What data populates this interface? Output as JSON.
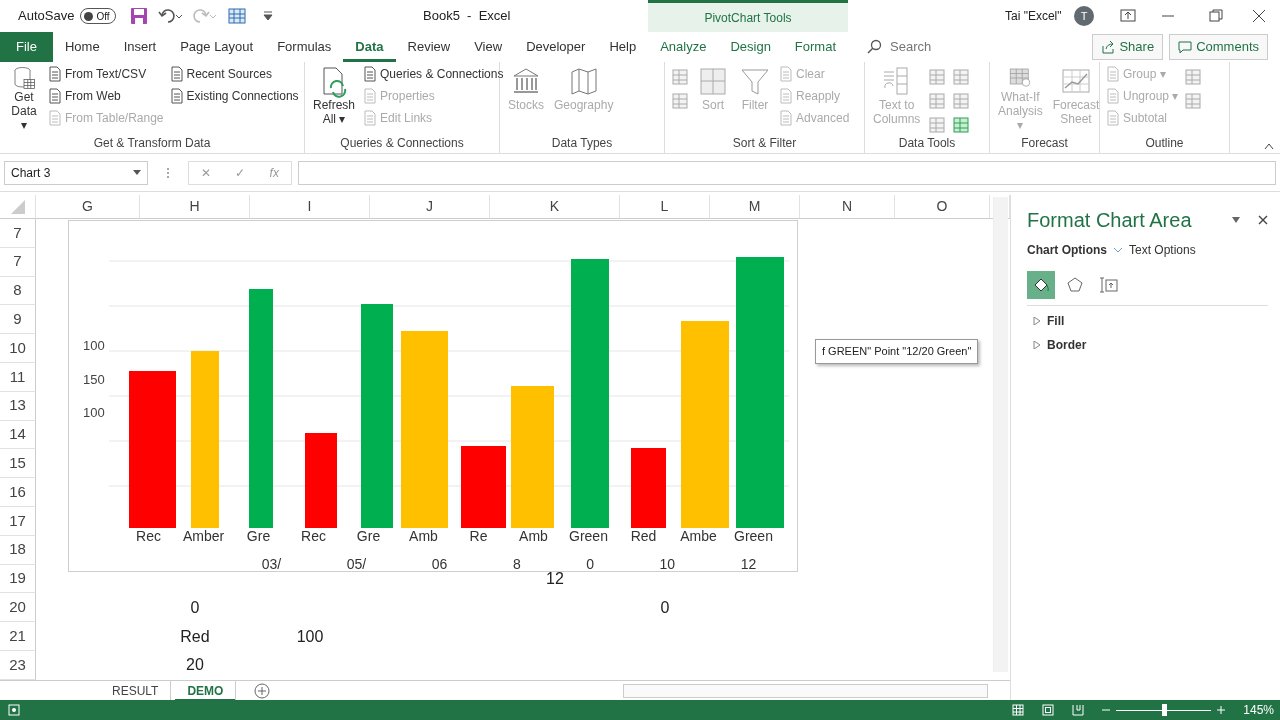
{
  "title_bar": {
    "autosave_label": "AutoSave",
    "autosave_on": false,
    "autosave_state": "Off",
    "document_title": "Book5  -  Excel",
    "context_tab": "PivotChart Tools",
    "user_name": "Tai \"Excel\"",
    "avatar_initial": "T"
  },
  "menu_tabs": [
    {
      "label": "File",
      "kind": "file",
      "selected": false
    },
    {
      "label": "Home",
      "kind": "tab",
      "selected": false
    },
    {
      "label": "Insert",
      "kind": "tab",
      "selected": false
    },
    {
      "label": "Page Layout",
      "kind": "tab",
      "selected": false
    },
    {
      "label": "Formulas",
      "kind": "tab",
      "selected": false
    },
    {
      "label": "Data",
      "kind": "tab",
      "selected": true
    },
    {
      "label": "Review",
      "kind": "tab",
      "selected": false
    },
    {
      "label": "View",
      "kind": "tab",
      "selected": false
    },
    {
      "label": "Developer",
      "kind": "tab",
      "selected": false
    },
    {
      "label": "Help",
      "kind": "tab",
      "selected": false
    },
    {
      "label": "Analyze",
      "kind": "context",
      "selected": false
    },
    {
      "label": "Design",
      "kind": "context",
      "selected": false
    },
    {
      "label": "Format",
      "kind": "context",
      "selected": false
    }
  ],
  "search": {
    "placeholder": "Search"
  },
  "share_button": "Share",
  "comments_button": "Comments",
  "ribbon_groups": [
    {
      "label": "Get & Transform Data",
      "columns": [
        {
          "kind": "large",
          "items": [
            {
              "label": "Get",
              "label2": "Data ▾",
              "disabled": false
            }
          ]
        },
        {
          "kind": "stack",
          "items": [
            {
              "label": "From Text/CSV",
              "disabled": false
            },
            {
              "label": "From Web",
              "disabled": false
            },
            {
              "label": "From Table/Range",
              "disabled": true
            }
          ]
        },
        {
          "kind": "stack",
          "items": [
            {
              "label": "Recent Sources",
              "disabled": false
            },
            {
              "label": "Existing Connections",
              "disabled": false
            }
          ]
        }
      ]
    },
    {
      "label": "Queries & Connections",
      "columns": [
        {
          "kind": "large",
          "items": [
            {
              "label": "Refresh",
              "label2": "All ▾",
              "disabled": false
            }
          ]
        },
        {
          "kind": "stack",
          "items": [
            {
              "label": "Queries & Connections",
              "disabled": false
            },
            {
              "label": "Properties",
              "disabled": true
            },
            {
              "label": "Edit Links",
              "disabled": true
            }
          ]
        }
      ]
    },
    {
      "label": "Data Types",
      "columns": [
        {
          "kind": "large",
          "items": [
            {
              "label": "Stocks",
              "disabled": true
            }
          ]
        },
        {
          "kind": "large",
          "items": [
            {
              "label": "Geography",
              "disabled": true
            }
          ]
        }
      ]
    },
    {
      "label": "Sort & Filter",
      "columns": [
        {
          "kind": "icons",
          "items": [
            {
              "disabled": true
            },
            {
              "disabled": true
            }
          ]
        },
        {
          "kind": "large",
          "items": [
            {
              "label": "Sort",
              "disabled": true
            }
          ]
        },
        {
          "kind": "large",
          "items": [
            {
              "label": "Filter",
              "disabled": true
            }
          ]
        },
        {
          "kind": "stack",
          "items": [
            {
              "label": "Clear",
              "disabled": true
            },
            {
              "label": "Reapply",
              "disabled": true
            },
            {
              "label": "Advanced",
              "disabled": true
            }
          ]
        }
      ]
    },
    {
      "label": "Data Tools",
      "columns": [
        {
          "kind": "large",
          "items": [
            {
              "label": "Text to",
              "label2": "Columns",
              "disabled": true
            }
          ]
        },
        {
          "kind": "icons",
          "items": [
            {
              "disabled": true
            },
            {
              "disabled": true
            },
            {
              "disabled": true
            }
          ]
        },
        {
          "kind": "icons",
          "items": [
            {
              "disabled": true
            },
            {
              "disabled": true
            },
            {
              "disabled": false
            }
          ]
        }
      ]
    },
    {
      "label": "Forecast",
      "columns": [
        {
          "kind": "large",
          "items": [
            {
              "label": "What-If",
              "label2": "Analysis ▾",
              "disabled": true
            }
          ]
        },
        {
          "kind": "large",
          "items": [
            {
              "label": "Forecast",
              "label2": "Sheet",
              "disabled": true
            }
          ]
        }
      ]
    },
    {
      "label": "Outline",
      "columns": [
        {
          "kind": "stack",
          "items": [
            {
              "label": "Group ▾",
              "disabled": true
            },
            {
              "label": "Ungroup ▾",
              "disabled": true
            },
            {
              "label": "Subtotal",
              "disabled": true
            }
          ]
        },
        {
          "kind": "icons",
          "items": [
            {
              "disabled": true
            },
            {
              "disabled": true
            }
          ]
        }
      ]
    }
  ],
  "name_box": "Chart 3",
  "formula_buttons": [
    "✕",
    "✓",
    "fx"
  ],
  "columns": [
    "G",
    "H",
    "I",
    "J",
    "K",
    "L",
    "M",
    "N",
    "O"
  ],
  "rows": [
    {
      "header": "7"
    },
    {
      "header": "7"
    },
    {
      "header": "8"
    },
    {
      "header": "9"
    },
    {
      "header": "10"
    },
    {
      "header": "11"
    },
    {
      "header": "13"
    },
    {
      "header": "14"
    },
    {
      "header": "15"
    },
    {
      "header": "16"
    },
    {
      "header": "17"
    },
    {
      "header": "18"
    },
    {
      "header": "19",
      "cells": [
        null,
        null,
        null,
        null,
        "12"
      ]
    },
    {
      "header": "20",
      "cells": [
        null,
        "0",
        null,
        null,
        null,
        "0"
      ]
    },
    {
      "header": "21",
      "cells": [
        null,
        "Red",
        "100"
      ]
    },
    {
      "header": "23",
      "cells": [
        null,
        "20"
      ]
    }
  ],
  "chart": {
    "axis_labels": [
      "100",
      "150",
      "100"
    ],
    "categories": [
      {
        "label": "Rec",
        "color": "#ff0000"
      },
      {
        "label": "Amber",
        "color": "#ffc000"
      },
      {
        "label": "Gre",
        "color": "#00b050"
      },
      {
        "label": "Rec",
        "color": "#ff0000"
      },
      {
        "label": "Gre",
        "color": "#00b050"
      },
      {
        "label": "Amb",
        "color": "#ffc000"
      },
      {
        "label": "Re",
        "color": "#ff0000"
      },
      {
        "label": "Amb",
        "color": "#ffc000"
      },
      {
        "label": "Green",
        "color": "#00b050"
      },
      {
        "label": "Red",
        "color": "#ff0000"
      },
      {
        "label": "Ambe",
        "color": "#ffc000"
      },
      {
        "label": "Green",
        "color": "#00b050"
      }
    ],
    "date_labels": [
      "03/",
      "05/",
      "06",
      "8",
      "0",
      "10",
      "12"
    ],
    "tooltip": "f GREEN\" Point \"12/20 Green\""
  },
  "format_pane": {
    "title": "Format Chart Area",
    "tabs": [
      {
        "label": "Chart Options",
        "selected": true
      },
      {
        "label": "Text Options",
        "selected": false
      }
    ],
    "icon_tabs": [
      {
        "selected": true
      },
      {
        "selected": false
      },
      {
        "selected": false
      }
    ],
    "sections": [
      {
        "label": "Fill",
        "expanded": false
      },
      {
        "label": "Border",
        "expanded": false
      }
    ]
  },
  "sheet_tabs": [
    {
      "label": "RESULT",
      "selected": false
    },
    {
      "label": "DEMO",
      "selected": true
    }
  ],
  "status_bar": {
    "zoom": "145%",
    "level": 0.5
  }
}
